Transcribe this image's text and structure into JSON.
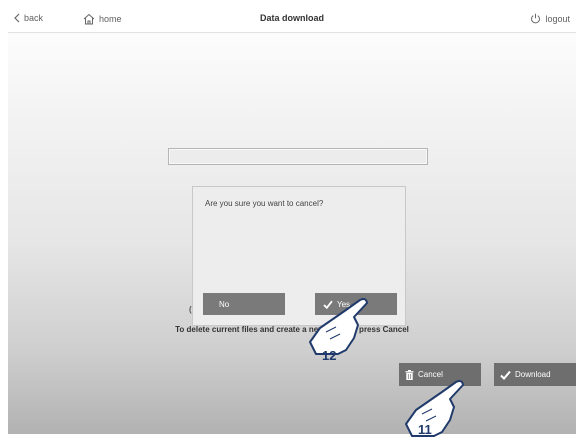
{
  "header": {
    "back_label": "back",
    "home_label": "home",
    "title": "Data download",
    "logout_label": "logout"
  },
  "dialog": {
    "question": "Are you sure you want to cancel?",
    "no_label": "No",
    "yes_label": "Yes"
  },
  "body": {
    "obscured_fragment": "(",
    "instruction": "To delete current files and create a new data set press Cancel"
  },
  "actions": {
    "cancel_label": "Cancel",
    "download_label": "Download"
  },
  "callouts": {
    "step_a": "12",
    "step_b": "11"
  },
  "icons": {
    "back": "chevron-left-icon",
    "home": "house-icon",
    "logout": "power-icon",
    "yes": "checkmark-icon",
    "cancel": "trash-icon",
    "download": "checkmark-icon",
    "pointer": "hand-pointer-icon"
  },
  "colors": {
    "button_gray": "#7a7a7a",
    "dialog_bg": "#ededed",
    "callout_fill": "#ffffff",
    "callout_stroke": "#1f3a6b"
  }
}
